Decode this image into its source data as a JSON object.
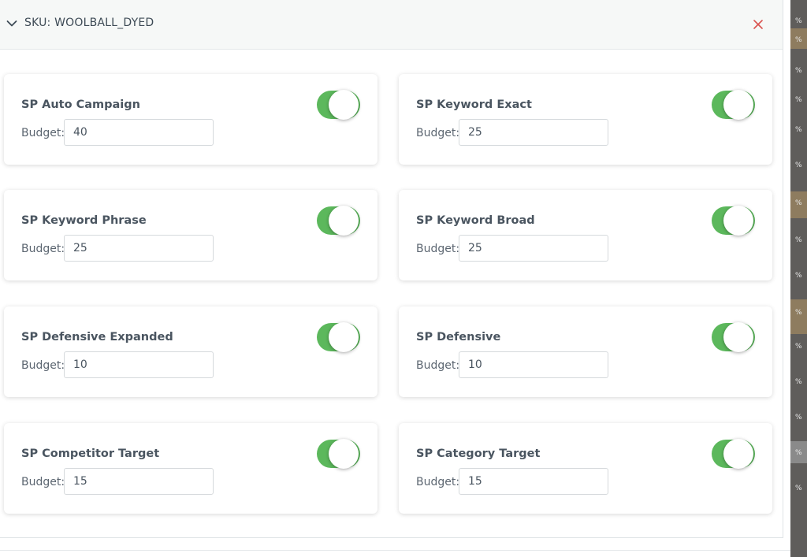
{
  "header": {
    "title": "SKU: WOOLBALL_DYED"
  },
  "campaigns": [
    {
      "title": "SP Auto Campaign",
      "budget_label": "Budget:",
      "budget": "40",
      "enabled": true
    },
    {
      "title": "SP Keyword Exact",
      "budget_label": "Budget:",
      "budget": "25",
      "enabled": true
    },
    {
      "title": "SP Keyword Phrase",
      "budget_label": "Budget:",
      "budget": "25",
      "enabled": true
    },
    {
      "title": "SP Keyword Broad",
      "budget_label": "Budget:",
      "budget": "25",
      "enabled": true
    },
    {
      "title": "SP Defensive Expanded",
      "budget_label": "Budget:",
      "budget": "10",
      "enabled": true
    },
    {
      "title": "SP Defensive",
      "budget_label": "Budget:",
      "budget": "10",
      "enabled": true
    },
    {
      "title": "SP Competitor Target",
      "budget_label": "Budget:",
      "budget": "15",
      "enabled": true
    },
    {
      "title": "SP Category Target",
      "budget_label": "Budget:",
      "budget": "15",
      "enabled": true
    }
  ],
  "background_strip": {
    "items": [
      "%",
      "%",
      "%",
      "%",
      "%",
      "%",
      "%",
      "%",
      "%",
      "%",
      "%",
      "%",
      "%",
      "%",
      "%"
    ]
  },
  "colors": {
    "toggle_on": "#5cb85c",
    "close_icon": "#d9534f",
    "header_bg": "#f6f8f7"
  },
  "icons": {
    "collapse": "chevron-down-icon",
    "close": "close-icon"
  }
}
